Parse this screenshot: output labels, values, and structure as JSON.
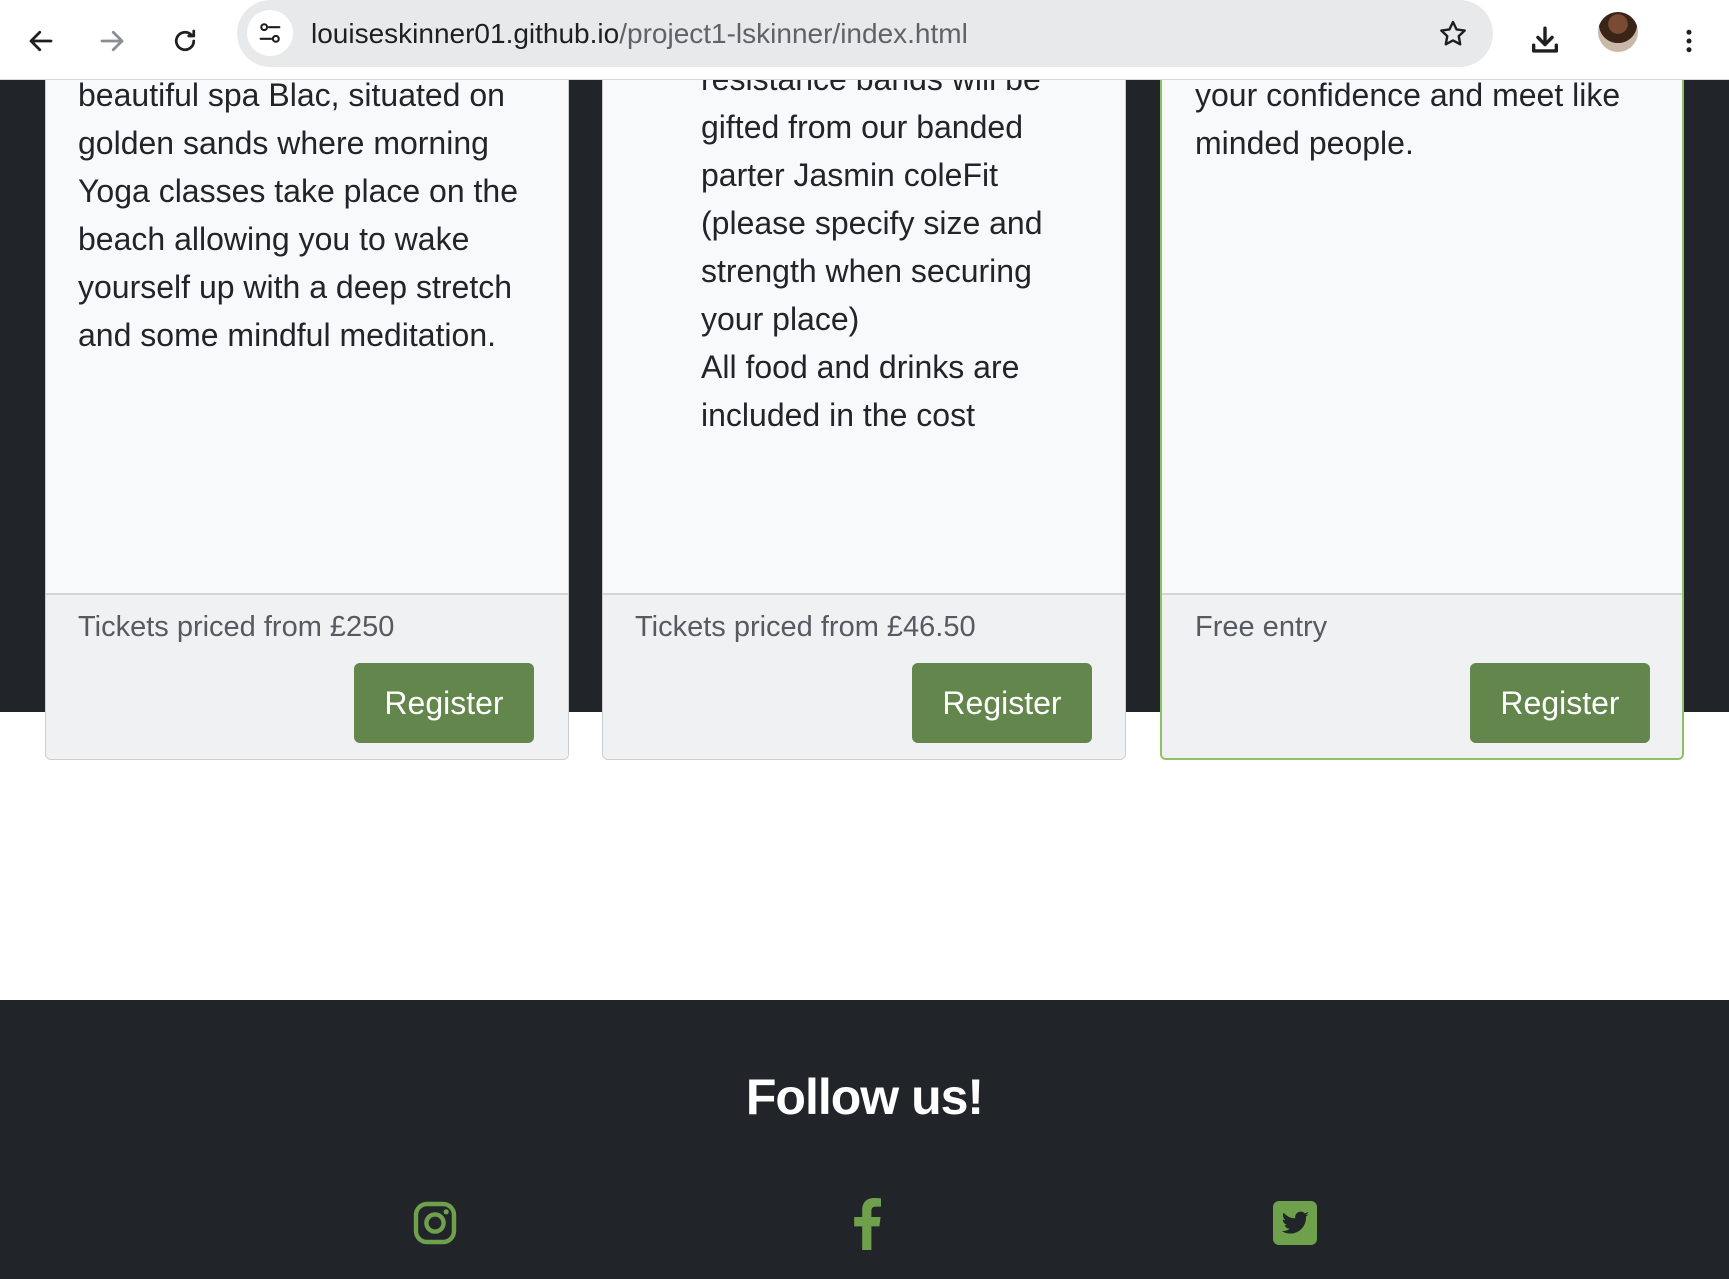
{
  "browser": {
    "url_host": "louiseskinner01.github.io",
    "url_path": "/project1-lskinner/index.html",
    "icons": [
      "back-icon",
      "forward-icon",
      "reload-icon",
      "site-info-icon",
      "bookmark-star-icon",
      "download-icon",
      "profile-avatar",
      "more-menu-icon"
    ]
  },
  "cards": [
    {
      "text_lines": [
        "beautiful spa Blac, situated on",
        "golden sands where morning",
        "Yoga classes take place on the",
        "beach allowing you to wake",
        "yourself up with a deep stretch",
        "and some mindful meditation."
      ],
      "price": "Tickets priced from £250",
      "button": "Register"
    },
    {
      "text_lines": [
        "resistance bands will be",
        "gifted from our banded",
        "parter Jasmin coleFit",
        "(please specify size and",
        "strength when securing",
        "your place)",
        "All food and drinks are",
        "included in the cost"
      ],
      "price": "Tickets priced from £46.50",
      "button": "Register"
    },
    {
      "text_lines": [
        "your confidence and meet like",
        "minded people."
      ],
      "price": "Free entry",
      "button": "Register"
    }
  ],
  "footer": {
    "title": "Follow us!",
    "social": [
      "instagram-icon",
      "facebook-icon",
      "twitter-icon"
    ]
  },
  "colors": {
    "dark_bg": "#212529",
    "button_green": "#63864c",
    "social_green": "#6fa04c",
    "highlight_border": "#8fbf66"
  }
}
